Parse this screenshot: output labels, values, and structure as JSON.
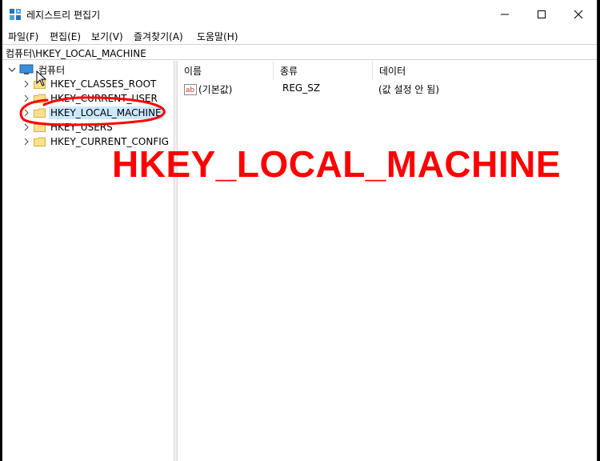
{
  "window": {
    "title": "레지스트리 편집기"
  },
  "menu": {
    "items": [
      "파일(F)",
      "편집(E)",
      "보기(V)",
      "즐겨찾기(A)",
      "도움말(H)"
    ]
  },
  "address": {
    "path": "컴퓨터\\HKEY_LOCAL_MACHINE"
  },
  "tree": {
    "root": "컴퓨터",
    "items": [
      {
        "label": "HKEY_CLASSES_ROOT"
      },
      {
        "label": "HKEY_CURRENT_USER"
      },
      {
        "label": "HKEY_LOCAL_MACHINE",
        "selected": true
      },
      {
        "label": "HKEY_USERS"
      },
      {
        "label": "HKEY_CURRENT_CONFIG"
      }
    ]
  },
  "list": {
    "columns": [
      "이름",
      "종류",
      "데이터"
    ],
    "rows": [
      {
        "name": "(기본값)",
        "type": "REG_SZ",
        "data": "(값 설정 안 됨)"
      }
    ]
  },
  "annotation": {
    "text": "HKEY_LOCAL_MACHINE",
    "color": "#ff0000"
  },
  "icons": {
    "app": "registry-icon",
    "computer": "computer-icon",
    "folder": "folder-icon",
    "value": "string-value-icon"
  }
}
